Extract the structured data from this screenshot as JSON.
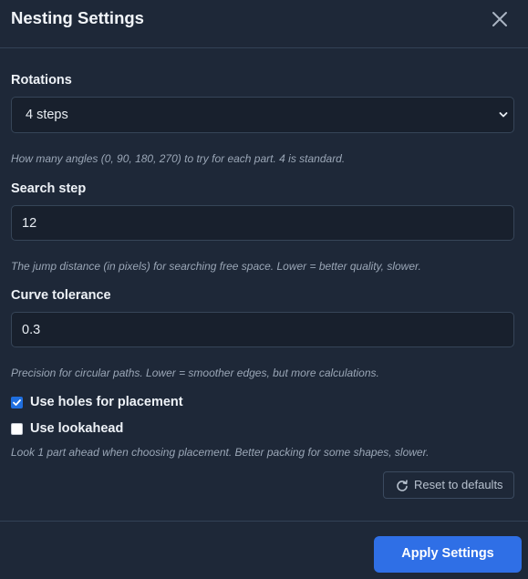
{
  "dialog": {
    "title": "Nesting Settings",
    "close_icon": "close-icon"
  },
  "rotations": {
    "label": "Rotations",
    "selected": "4 steps",
    "help": "How many angles (0, 90, 180, 270) to try for each part. 4 is standard."
  },
  "search_step": {
    "label": "Search step",
    "value": "12",
    "help": "The jump distance (in pixels) for searching free space. Lower = better quality, slower."
  },
  "curve_tolerance": {
    "label": "Curve tolerance",
    "value": "0.3",
    "help": "Precision for circular paths. Lower = smoother edges, but more calculations."
  },
  "use_holes": {
    "label": "Use holes for placement",
    "checked": true
  },
  "use_lookahead": {
    "label": "Use lookahead",
    "checked": false,
    "help": "Look 1 part ahead when choosing placement. Better packing for some shapes, slower."
  },
  "reset_button": {
    "label": "Reset to defaults",
    "icon": "refresh-icon"
  },
  "apply_button": {
    "label": "Apply Settings"
  },
  "colors": {
    "background": "#1e2838",
    "accent": "#2f6fe6",
    "field_bg": "#18202d"
  }
}
